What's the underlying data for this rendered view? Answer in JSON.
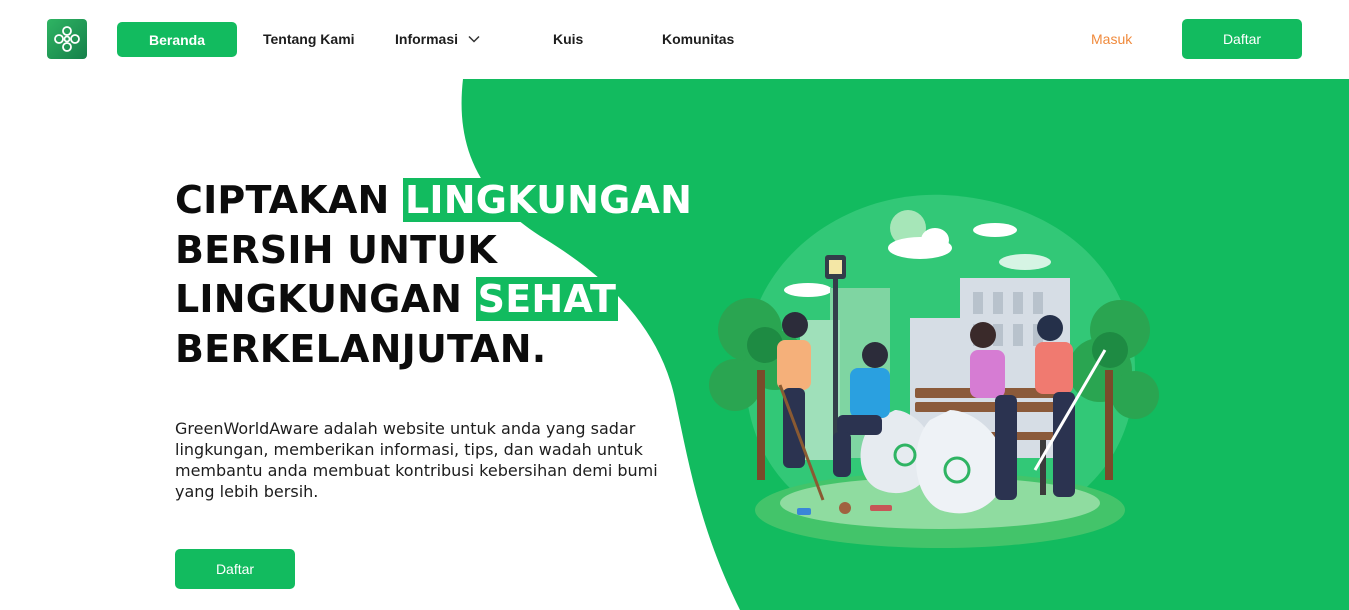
{
  "nav": {
    "logo_icon": "knot-logo-icon",
    "items": [
      {
        "label": "Beranda",
        "active": true
      },
      {
        "label": "Tentang Kami"
      },
      {
        "label": "Informasi",
        "icon": "chevron-down-icon"
      },
      {
        "label": "Kuis"
      },
      {
        "label": "Komunitas"
      }
    ],
    "login_label": "Masuk",
    "register_label": "Daftar"
  },
  "hero": {
    "title_line1_plain": "CIPTAKAN ",
    "title_line1_highlight": "LINGKUNGAN",
    "title_line2": "BERSIH UNTUK",
    "title_line3_plain": "LINGKUNGAN ",
    "title_line3_highlight": "SEHAT",
    "title_line4": "BERKELANJUTAN.",
    "description": "GreenWorldAware adalah website untuk anda yang sadar lingkungan, memberikan informasi, tips, dan wadah untuk membantu anda membuat kontribusi kebersihan demi bumi yang lebih bersih.",
    "cta_label": "Daftar",
    "illustration_icon": "park-cleanup-illustration"
  },
  "colors": {
    "brand_green": "#12bb5f",
    "login_orange": "#f08a3c",
    "text_dark": "#0c0c0c"
  }
}
